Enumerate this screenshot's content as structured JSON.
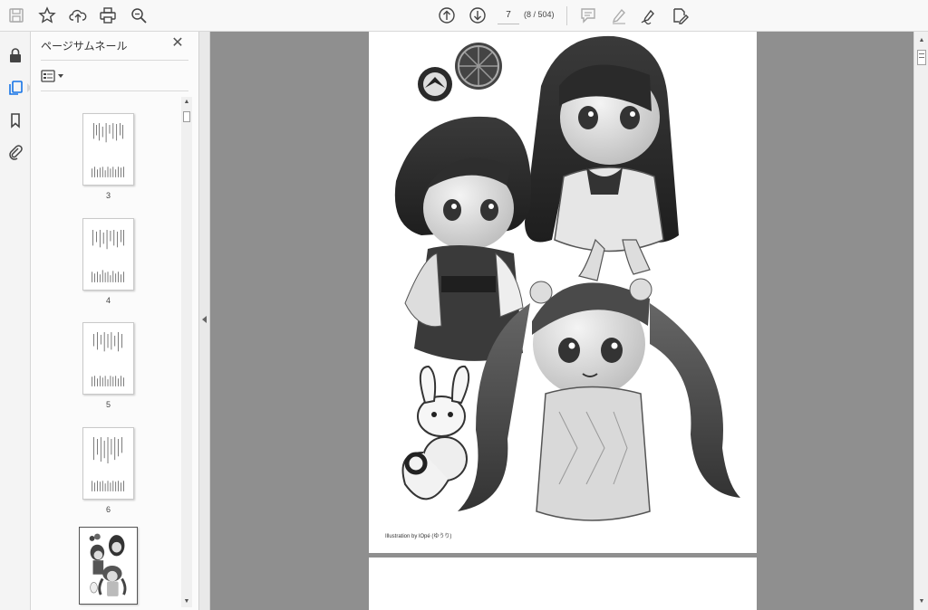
{
  "toolbar": {
    "left_icons": [
      "save-icon",
      "star-icon",
      "cloud-upload-icon",
      "print-icon",
      "zoom-search-icon"
    ],
    "current_page": "7",
    "page_count": "(8 / 504)",
    "right_icons": [
      "comment-icon",
      "highlight-pen-icon",
      "sign-pen-icon",
      "edit-pdf-icon"
    ]
  },
  "rail": {
    "icons": [
      "lock-icon",
      "page-thumbnails-icon",
      "bookmark-icon",
      "attachment-clip-icon"
    ],
    "active": "page-thumbnails-icon",
    "accent_color": "#1473e6"
  },
  "thumbnail_panel": {
    "title": "ページサムネール",
    "close_symbol": "✕",
    "thumbnails": [
      {
        "label": "3"
      },
      {
        "label": "4"
      },
      {
        "label": "5"
      },
      {
        "label": "6"
      },
      {
        "label": "",
        "selected": true
      }
    ]
  },
  "document": {
    "credit": "Illustration by lOpé (ゆうり)"
  }
}
